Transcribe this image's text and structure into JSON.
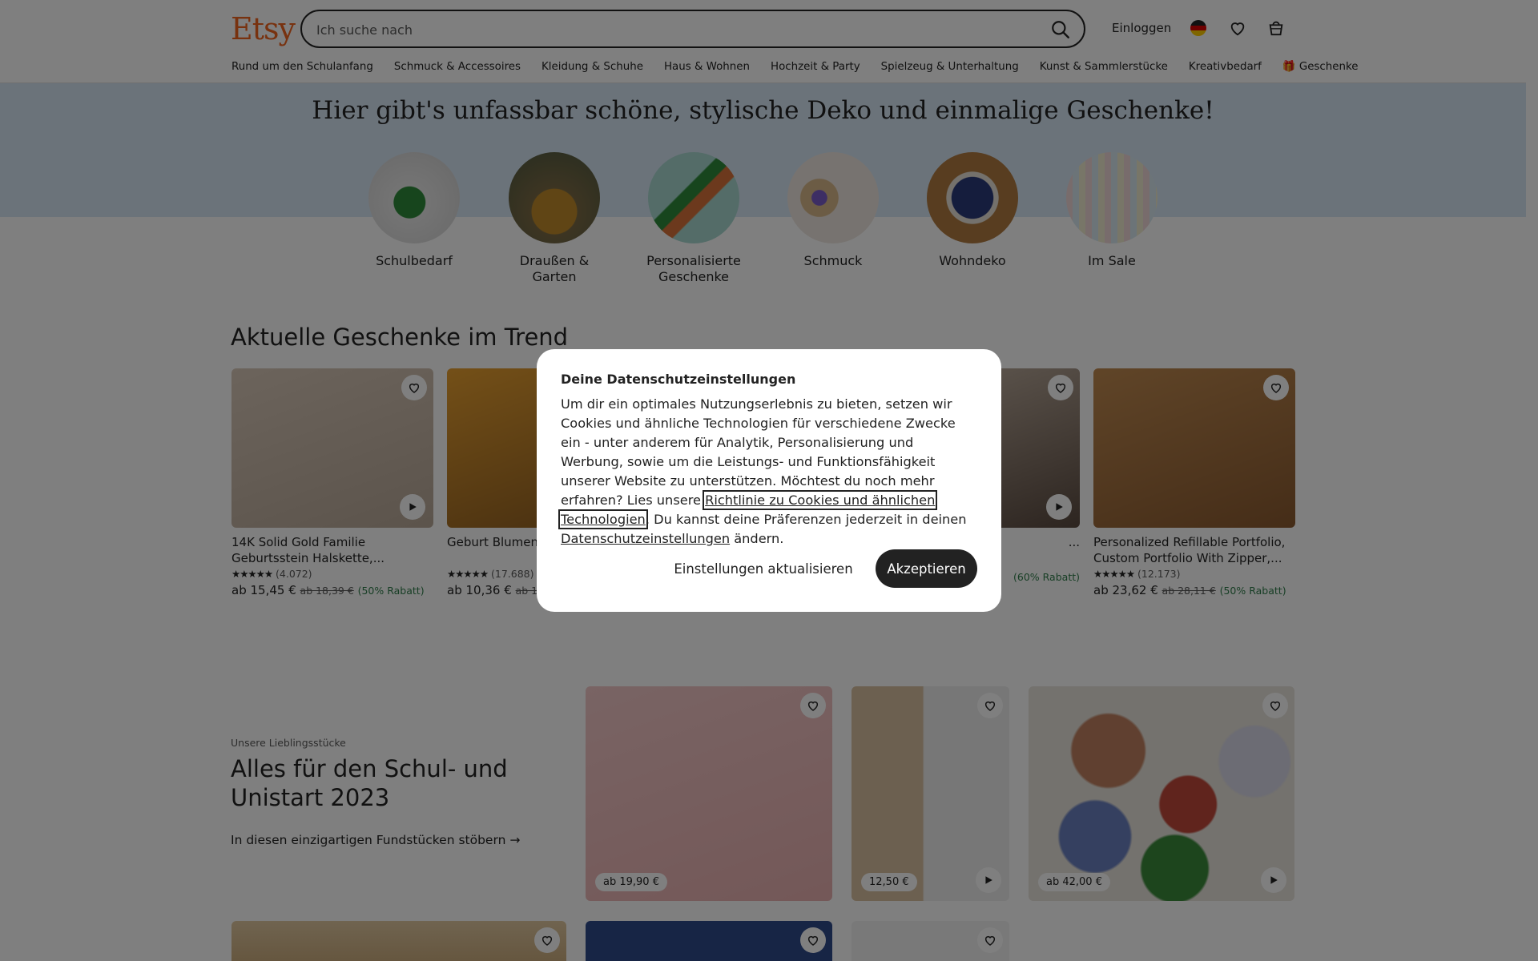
{
  "header": {
    "logo": "Etsy",
    "search_placeholder": "Ich suche nach",
    "login": "Einloggen"
  },
  "nav": [
    "Rund um den Schulanfang",
    "Schmuck & Accessoires",
    "Kleidung & Schuhe",
    "Haus & Wohnen",
    "Hochzeit & Party",
    "Spielzeug & Unterhaltung",
    "Kunst & Sammlerstücke",
    "Kreativbedarf",
    "Geschenke"
  ],
  "banner": {
    "title": "Hier gibt's unfassbar schöne, stylische Deko und einmalige Geschenke!",
    "categories": [
      {
        "label": "Schulbedarf"
      },
      {
        "label": "Draußen & Garten"
      },
      {
        "label": "Personalisierte Geschenke"
      },
      {
        "label": "Schmuck"
      },
      {
        "label": "Wohndeko"
      },
      {
        "label": "Im Sale"
      }
    ]
  },
  "trend": {
    "title": "Aktuelle Geschenke im Trend",
    "items": [
      {
        "title": "14K Solid Gold Familie Geburtsstein Halskette,...",
        "stars": "★★★★★",
        "reviews": "(4.072)",
        "price": "ab 15,45 €",
        "old": "ab 18,39 €",
        "discount": "(50% Rabatt)"
      },
      {
        "title": "Geburt Blumen Reiseetui, Geb...",
        "stars": "★★★★★",
        "reviews": "(17.688)",
        "price": "ab 10,36 €",
        "old": "ab 12,...",
        "discount": ""
      },
      {
        "title": "...",
        "stars": "",
        "reviews": "",
        "price": "",
        "old": "",
        "discount": "(60% Rabatt)"
      },
      {
        "title": "Personalized Refillable Portfolio, Custom Portfolio With Zipper,...",
        "stars": "★★★★★",
        "reviews": "(12.173)",
        "price": "ab 23,62 €",
        "old": "ab 28,11 €",
        "discount": "(50% Rabatt)"
      }
    ]
  },
  "section2": {
    "kicker": "Unsere Lieblingsstücke",
    "title": "Alles für den Schul- und Unistart 2023",
    "link": "In diesen einzigartigen Fundstücken stöbern",
    "tiles": [
      {
        "price": "ab 19,90 €"
      },
      {
        "price": "12,50 €"
      },
      {
        "price": "ab 42,00 €"
      }
    ]
  },
  "modal": {
    "title": "Deine Datenschutzeinstellungen",
    "text1": "Um dir ein optimales Nutzungserlebnis zu bieten, setzen wir Cookies und ähnliche Technologien für verschiedene Zwecke ein - unter anderem für Analytik, Personalisierung und Werbung, sowie um die Leistungs- und Funktionsfähigkeit unserer Website zu unterstützen. Möchtest du noch mehr erfahren? Lies unsere ",
    "link1": "Richtlinie zu Cookies und ähnlichen Technologien",
    "text2": ". Du kannst deine Präferenzen jederzeit in deinen ",
    "link2": "Datenschutzeinstellungen",
    "text3": " ändern.",
    "btn_settings": "Einstellungen aktualisieren",
    "btn_accept": "Akzeptieren"
  },
  "colors": {
    "brand": "#f1641e",
    "banner": "#d7e6f5",
    "discount": "#2f7d4a"
  }
}
